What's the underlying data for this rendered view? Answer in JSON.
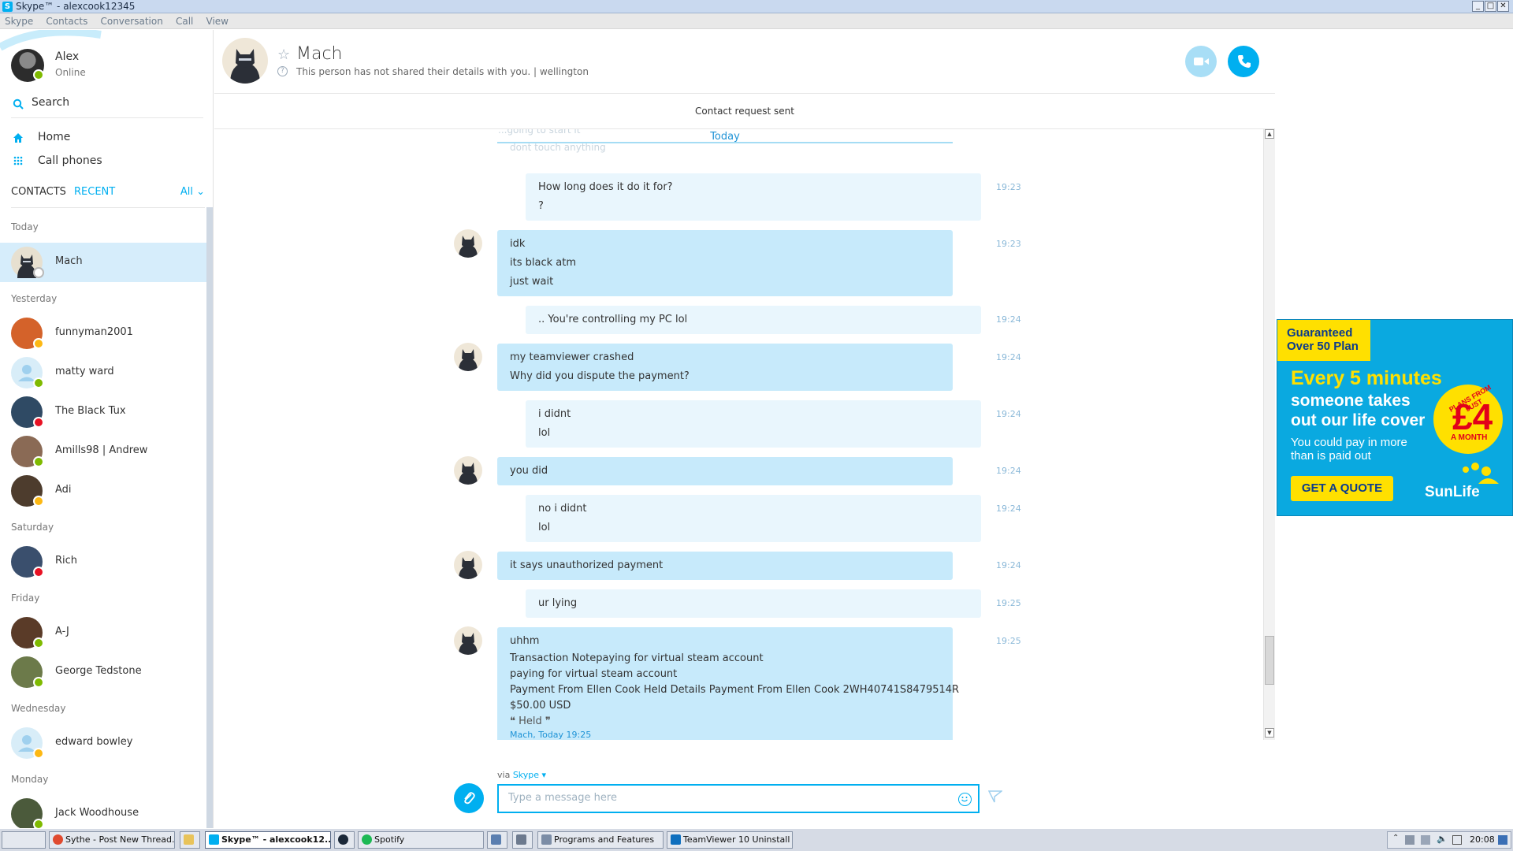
{
  "window": {
    "title": "Skype™ - alexcook12345",
    "min": "_",
    "max": "□",
    "close": "✕"
  },
  "menu": [
    "Skype",
    "Contacts",
    "Conversation",
    "Call",
    "View"
  ],
  "profile": {
    "name": "Alex",
    "status": "Online"
  },
  "search": {
    "label": "Search"
  },
  "nav": {
    "home": "Home",
    "call_phones": "Call phones"
  },
  "tabs": {
    "contacts": "CONTACTS",
    "recent": "RECENT",
    "filter": "All"
  },
  "groups": {
    "today": "Today",
    "yesterday": "Yesterday",
    "saturday": "Saturday",
    "friday": "Friday",
    "wednesday": "Wednesday",
    "monday": "Monday"
  },
  "contacts": [
    {
      "name": "Mach",
      "status": "offline",
      "color": "#3c4654"
    },
    {
      "name": "funnyman2001",
      "status": "away",
      "color": "#d4622a"
    },
    {
      "name": "matty ward",
      "status": "online",
      "color": "#c7e4f5"
    },
    {
      "name": "The Black Tux",
      "status": "busy",
      "color": "#2f4a64"
    },
    {
      "name": "Amills98 | Andrew",
      "status": "online",
      "color": "#8a6a55"
    },
    {
      "name": "Adi",
      "status": "away",
      "color": "#4d3c2d"
    },
    {
      "name": "Rich",
      "status": "busy",
      "color": "#3a4f6d"
    },
    {
      "name": "A-J",
      "status": "online",
      "color": "#5a3b28"
    },
    {
      "name": "George Tedstone",
      "status": "online",
      "color": "#6c7a4a"
    },
    {
      "name": "edward bowley",
      "status": "away",
      "color": "#c7e4f5"
    },
    {
      "name": "Jack Woodhouse",
      "status": "online",
      "color": "#4b5a3b"
    }
  ],
  "header": {
    "name": "Mach",
    "info": "This person has not shared their details with you.  |  wellington",
    "request": "Contact request sent"
  },
  "messages": {
    "faded_1": "...going to start it",
    "faded_2": "dont touch anything",
    "day": "Today",
    "m1": {
      "lines": [
        "How long does it do it for?",
        "?"
      ],
      "time": "19:23"
    },
    "m2": {
      "lines": [
        "idk",
        "its black atm",
        "just wait"
      ],
      "time": "19:23"
    },
    "m3": {
      "lines": [
        ".. You're controlling my PC lol"
      ],
      "time": "19:24"
    },
    "m4": {
      "lines": [
        "my teamviewer crashed",
        "Why did you dispute the payment?"
      ],
      "time": "19:24"
    },
    "m5": {
      "lines": [
        "i didnt",
        "lol"
      ],
      "time": "19:24"
    },
    "m6": {
      "lines": [
        "you did"
      ],
      "time": "19:24"
    },
    "m7": {
      "lines": [
        "no i didnt",
        "lol"
      ],
      "time": "19:24"
    },
    "m8": {
      "lines": [
        "it says unauthorized payment"
      ],
      "time": "19:24"
    },
    "m9": {
      "lines": [
        "ur lying"
      ],
      "time": "19:25"
    },
    "m10": {
      "lines": [
        "uhhm",
        " Transaction Notepaying for virtual steam account",
        "paying for virtual steam account",
        "Payment From Ellen Cook Held Details Payment From Ellen Cook 2WH40741S8479514R",
        "$50.00 USD"
      ],
      "quote": "Held",
      "quote_sig": "Mach, Today 19:25",
      "time": "19:25"
    }
  },
  "compose": {
    "via": "via",
    "via_service": "Skype",
    "placeholder": "Type a message here"
  },
  "ad": {
    "badge": "Guaranteed Over 50 Plan",
    "headline": "Every 5 minutes",
    "subline": "someone takes out our life cover",
    "small": "You could pay in more than is paid out",
    "circle_top": "PLANS FROM JUST",
    "price": "£4",
    "circle_bottom": "A MONTH",
    "cta": "GET A QUOTE",
    "logo": "SunLife"
  },
  "taskbar": {
    "items": [
      "Sythe - Post New Thread...",
      "Skype™ - alexcook12...",
      "Spotify",
      "Programs and Features",
      "TeamViewer 10 Uninstall"
    ],
    "clock": "20:08"
  },
  "colors": {
    "accent": "#00aff0",
    "bubble_in": "#c7eafb",
    "bubble_out": "#e9f6fd",
    "active_row": "#d6edfb"
  }
}
